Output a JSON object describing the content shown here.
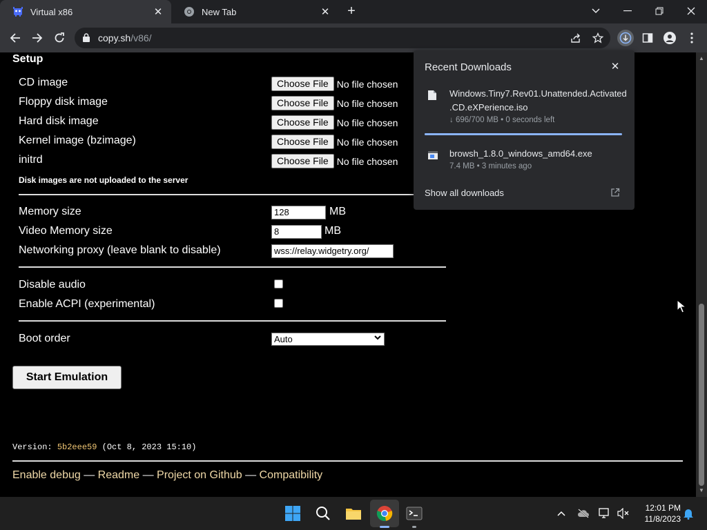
{
  "tabs": [
    {
      "title": "Virtual x86",
      "active": true
    },
    {
      "title": "New Tab",
      "active": false
    }
  ],
  "toolbar": {
    "url_host": "copy.sh",
    "url_path": "/v86/"
  },
  "setup": {
    "heading": "Setup",
    "file_rows": [
      {
        "label": "CD image",
        "button": "Choose File",
        "status": "No file chosen"
      },
      {
        "label": "Floppy disk image",
        "button": "Choose File",
        "status": "No file chosen"
      },
      {
        "label": "Hard disk image",
        "button": "Choose File",
        "status": "No file chosen"
      },
      {
        "label": "Kernel image (bzimage)",
        "button": "Choose File",
        "status": "No file chosen"
      },
      {
        "label": "initrd",
        "button": "Choose File",
        "status": "No file chosen"
      }
    ],
    "note": "Disk images are not uploaded to the server",
    "memory": {
      "label": "Memory size",
      "value": "128",
      "unit": "MB"
    },
    "vmemory": {
      "label": "Video Memory size",
      "value": "8",
      "unit": "MB"
    },
    "proxy": {
      "label": "Networking proxy (leave blank to disable)",
      "value": "wss://relay.widgetry.org/"
    },
    "disable_audio": {
      "label": "Disable audio",
      "checked": false
    },
    "acpi": {
      "label": "Enable ACPI (experimental)",
      "checked": false
    },
    "boot_order": {
      "label": "Boot order",
      "selected": "Auto"
    },
    "start_button": "Start Emulation"
  },
  "version": {
    "prefix": "Version: ",
    "hash": "5b2eee59",
    "date": " (Oct 8, 2023 15:10)"
  },
  "footer": {
    "links": [
      "Enable debug",
      "Readme",
      "Project on Github",
      "Compatibility"
    ],
    "separator": " — "
  },
  "downloads": {
    "title": "Recent Downloads",
    "items": [
      {
        "name": "Windows.Tiny7.Rev01.Unattended.Activated.CD.eXPerience.iso",
        "name_line1": "Windows.Tiny7.Rev01.Unattended.Activated",
        "name_line2": ".CD.eXPerience.iso",
        "status": "↓ 696/700 MB • 0 seconds left",
        "progress": 0.994
      },
      {
        "name": "browsh_1.8.0_windows_amd64.exe",
        "status": "7.4 MB • 3 minutes ago"
      }
    ],
    "show_all": "Show all downloads"
  },
  "taskbar": {
    "time": "12:01 PM",
    "date": "11/8/2023"
  },
  "colors": {
    "accent": "#8ab4f8",
    "link": "#f0d9a8",
    "hash": "#f0c674"
  }
}
